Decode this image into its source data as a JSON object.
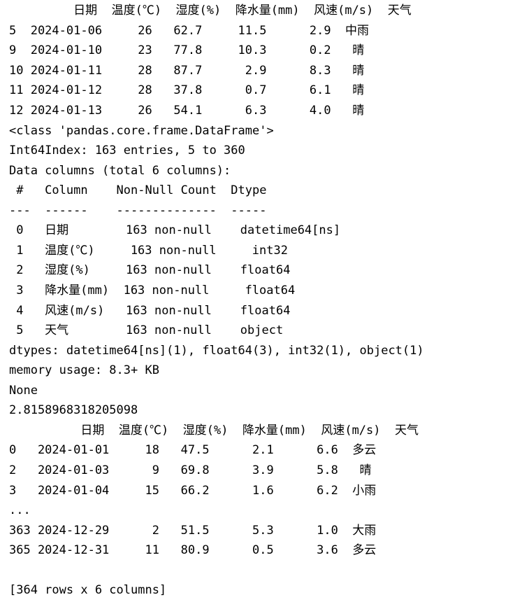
{
  "output_lines": [
    "         日期  温度(℃)  湿度(%)  降水量(mm)  风速(m/s)  天气",
    "5  2024-01-06     26   62.7     11.5      2.9  中雨",
    "9  2024-01-10     23   77.8     10.3      0.2   晴",
    "10 2024-01-11     28   87.7      2.9      8.3   晴",
    "11 2024-01-12     28   37.8      0.7      6.1   晴",
    "12 2024-01-13     26   54.1      6.3      4.0   晴",
    "<class 'pandas.core.frame.DataFrame'>",
    "Int64Index: 163 entries, 5 to 360",
    "Data columns (total 6 columns):",
    " #   Column    Non-Null Count  Dtype",
    "---  ------    --------------  -----",
    " 0   日期        163 non-null    datetime64[ns]",
    " 1   温度(℃)     163 non-null     int32",
    " 2   湿度(%)     163 non-null    float64",
    " 3   降水量(mm)  163 non-null     float64",
    " 4   风速(m/s)   163 non-null    float64",
    " 5   天气        163 non-null    object",
    "dtypes: datetime64[ns](1), float64(3), int32(1), object(1)",
    "memory usage: 8.3+ KB",
    "None",
    "2.8158968318205098",
    "          日期  温度(℃)  湿度(%)  降水量(mm)  风速(m/s)  天气",
    "0   2024-01-01     18   47.5      2.1      6.6  多云",
    "2   2024-01-03      9   69.8      3.9      5.8   晴",
    "3   2024-01-04     15   66.2      1.6      6.2  小雨",
    "...",
    "363 2024-12-29      2   51.5      5.3      1.0  大雨",
    "365 2024-12-31     11   80.9      0.5      3.6  多云",
    "",
    "[364 rows x 6 columns]"
  ]
}
